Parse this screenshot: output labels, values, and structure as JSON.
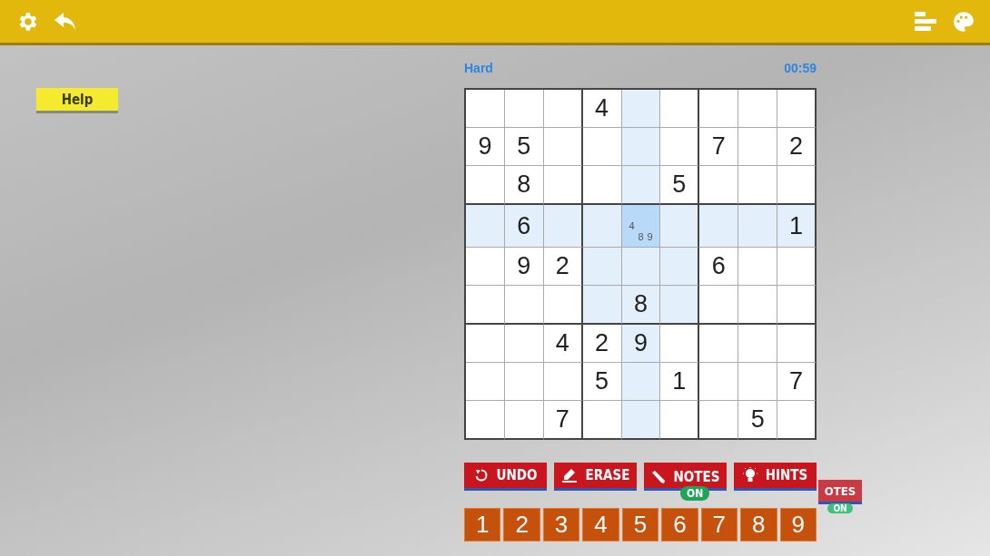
{
  "top_bar": {
    "left_icons": [
      {
        "kind": "settings"
      },
      {
        "kind": "back"
      }
    ],
    "right_icons": [
      {
        "kind": "bars"
      },
      {
        "kind": "palette"
      }
    ]
  },
  "help_button": {
    "label": "Help"
  },
  "difficulty": "Hard",
  "timer": "00:59",
  "board": {
    "rows": [
      {
        "cells": [
          {
            "selected": false
          },
          {
            "selected": false
          },
          {
            "selected": false
          },
          {
            "value": "4",
            "selected": false
          },
          {
            "selected": false
          },
          {
            "selected": false
          },
          {
            "selected": false
          },
          {
            "selected": false
          },
          {
            "selected": false
          }
        ]
      },
      {
        "cells": [
          {
            "value": "9",
            "selected": false
          },
          {
            "value": "5",
            "selected": false
          },
          {
            "selected": false
          },
          {
            "selected": false
          },
          {
            "selected": false
          },
          {
            "selected": false
          },
          {
            "value": "7",
            "selected": false
          },
          {
            "selected": false
          },
          {
            "value": "2",
            "selected": false
          }
        ]
      },
      {
        "cells": [
          {
            "selected": false
          },
          {
            "value": "8",
            "selected": false
          },
          {
            "selected": false
          },
          {
            "selected": false
          },
          {
            "selected": false
          },
          {
            "value": "5",
            "selected": false
          },
          {
            "selected": false
          },
          {
            "selected": false
          },
          {
            "selected": false
          }
        ]
      },
      {
        "cells": [
          {
            "selected": false
          },
          {
            "value": "6",
            "selected": false
          },
          {
            "selected": false
          },
          {
            "selected": false
          },
          {
            "notes": [
              "4",
              "8",
              "9"
            ],
            "selected": true
          },
          {
            "selected": false
          },
          {
            "selected": false
          },
          {
            "selected": false
          },
          {
            "value": "1",
            "selected": false
          }
        ]
      },
      {
        "cells": [
          {
            "selected": false
          },
          {
            "value": "9",
            "selected": false
          },
          {
            "value": "2",
            "selected": false
          },
          {
            "selected": false
          },
          {
            "selected": false
          },
          {
            "selected": false
          },
          {
            "value": "6",
            "selected": false
          },
          {
            "selected": false
          },
          {
            "selected": false
          }
        ]
      },
      {
        "cells": [
          {
            "selected": false
          },
          {
            "selected": false
          },
          {
            "selected": false
          },
          {
            "selected": false
          },
          {
            "value": "8",
            "selected": false
          },
          {
            "selected": false
          },
          {
            "selected": false
          },
          {
            "selected": false
          },
          {
            "selected": false
          }
        ]
      },
      {
        "cells": [
          {
            "selected": false
          },
          {
            "selected": false
          },
          {
            "value": "4",
            "selected": false
          },
          {
            "value": "2",
            "selected": false
          },
          {
            "value": "9",
            "selected": false
          },
          {
            "selected": false
          },
          {
            "selected": false
          },
          {
            "selected": false
          },
          {
            "selected": false
          }
        ]
      },
      {
        "cells": [
          {
            "selected": false
          },
          {
            "selected": false
          },
          {
            "selected": false
          },
          {
            "value": "5",
            "selected": false
          },
          {
            "selected": false
          },
          {
            "value": "1",
            "selected": false
          },
          {
            "selected": false
          },
          {
            "selected": false
          },
          {
            "value": "7",
            "selected": false
          }
        ]
      },
      {
        "cells": [
          {
            "selected": false
          },
          {
            "selected": false
          },
          {
            "value": "7",
            "selected": false
          },
          {
            "selected": false
          },
          {
            "selected": false
          },
          {
            "selected": false
          },
          {
            "selected": false
          },
          {
            "value": "5",
            "selected": false
          },
          {
            "selected": false
          }
        ]
      }
    ]
  },
  "actions": [
    {
      "kind": "undo",
      "label": "UNDO"
    },
    {
      "kind": "erase",
      "label": "ERASE"
    },
    {
      "kind": "notes",
      "label": "NOTES",
      "badge": "ON"
    },
    {
      "kind": "hints",
      "label": "HINTS"
    }
  ],
  "ghost_button": {
    "label": "OTES",
    "badge": "ON"
  },
  "number_keys": [
    "1",
    "2",
    "3",
    "4",
    "5",
    "6",
    "7",
    "8",
    "9"
  ]
}
